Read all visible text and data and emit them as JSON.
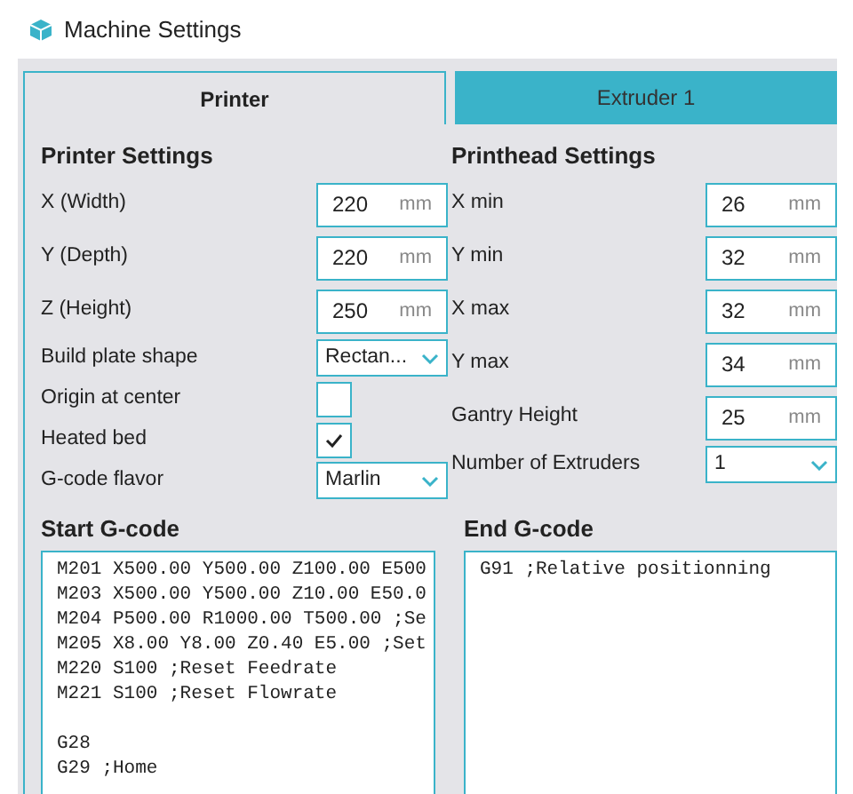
{
  "window": {
    "title": "Machine Settings"
  },
  "tabs": [
    {
      "label": "Printer",
      "selected": true
    },
    {
      "label": "Extruder 1",
      "selected": false
    }
  ],
  "printer_settings": {
    "title": "Printer Settings",
    "rows": [
      {
        "kind": "number",
        "label": "X (Width)",
        "value": "220",
        "unit": "mm"
      },
      {
        "kind": "number",
        "label": "Y (Depth)",
        "value": "220",
        "unit": "mm"
      },
      {
        "kind": "number",
        "label": "Z (Height)",
        "value": "250",
        "unit": "mm"
      },
      {
        "kind": "dropdown",
        "label": "Build plate shape",
        "value": "Rectan..."
      },
      {
        "kind": "checkbox",
        "label": "Origin at center",
        "checked": false
      },
      {
        "kind": "checkbox",
        "label": "Heated bed",
        "checked": true
      },
      {
        "kind": "dropdown",
        "label": "G-code flavor",
        "value": "Marlin"
      }
    ]
  },
  "printhead_settings": {
    "title": "Printhead Settings",
    "rows": [
      {
        "kind": "number",
        "label": "X min",
        "value": "26",
        "unit": "mm"
      },
      {
        "kind": "number",
        "label": "Y min",
        "value": "32",
        "unit": "mm"
      },
      {
        "kind": "number",
        "label": "X max",
        "value": "32",
        "unit": "mm"
      },
      {
        "kind": "number",
        "label": "Y max",
        "value": "34",
        "unit": "mm"
      },
      {
        "kind": "number",
        "label": "Gantry Height",
        "value": "25",
        "unit": "mm"
      },
      {
        "kind": "dropdown",
        "label": "Number of Extruders",
        "value": "1"
      }
    ]
  },
  "start_gcode": {
    "title": "Start G-code",
    "blocks": [
      [
        "M201 X500.00 Y500.00 Z100.00 E500",
        "M203 X500.00 Y500.00 Z10.00 E50.0",
        "M204 P500.00 R1000.00 T500.00 ;Se",
        "M205 X8.00 Y8.00 Z0.40 E5.00 ;Set",
        "M220 S100 ;Reset Feedrate",
        "M221 S100 ;Reset Flowrate"
      ],
      [
        "G28",
        "G29 ;Home"
      ]
    ]
  },
  "end_gcode": {
    "title": "End G-code",
    "blocks": [
      [
        "G91 ;Relative positionning"
      ]
    ]
  }
}
